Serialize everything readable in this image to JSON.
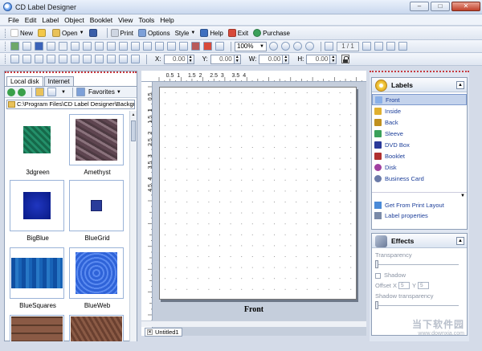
{
  "window": {
    "title": "CD Label Designer",
    "minimize": "–",
    "maximize": "□",
    "close": "✕"
  },
  "menu": [
    "File",
    "Edit",
    "Label",
    "Object",
    "Booklet",
    "View",
    "Tools",
    "Help"
  ],
  "toolbar1": {
    "new": "New",
    "open": "Open",
    "print": "Print",
    "options": "Options",
    "style": "Style",
    "help": "Help",
    "exit": "Exit",
    "purchase": "Purchase"
  },
  "toolbar2": {
    "zoom": "100%",
    "page": "1 / 1"
  },
  "toolbar3": {
    "x_label": "X:",
    "x_value": "0.00",
    "y_label": "Y:",
    "y_value": "0.00",
    "w_label": "W:",
    "w_value": "0.00",
    "h_label": "H:",
    "h_value": "0.00"
  },
  "left_panel": {
    "tabs": [
      "Local disk",
      "Internet"
    ],
    "favorites": "Favorites",
    "path": "C:\\Program Files\\CD Label Designer\\Backgrounds",
    "thumbs": [
      {
        "label": "3dgreen",
        "color": "#1e7a55"
      },
      {
        "label": "Amethyst",
        "color": "#6e5560"
      },
      {
        "label": "BigBlue",
        "color": "#0d1fa0"
      },
      {
        "label": "BlueGrid",
        "color": "#2a3c9a"
      },
      {
        "label": "BlueSquares",
        "color": "#4f9fd8"
      },
      {
        "label": "BlueWeb",
        "color": "#2f63d8"
      },
      {
        "label": "",
        "color": "#8a5a45"
      },
      {
        "label": "",
        "color": "#6a4030"
      }
    ]
  },
  "ruler": {
    "h": [
      "0.5",
      "1",
      "1.5",
      "2",
      "2.5",
      "3",
      "3.5",
      "4"
    ],
    "v": [
      "0.5",
      "1",
      "1.5",
      "2",
      "2.5",
      "3",
      "3.5",
      "4",
      "4.5"
    ]
  },
  "canvas": {
    "label": "Front"
  },
  "doc_tab": "Untitled1",
  "labels_panel": {
    "title": "Labels",
    "items": [
      "Front",
      "Inside",
      "Back",
      "Sleeve",
      "DVD Box",
      "Booklet",
      "Disk",
      "Business Card"
    ],
    "selected": 0,
    "actions": [
      "Get From Print Layout",
      "Label properties"
    ]
  },
  "effects_panel": {
    "title": "Effects",
    "transparency": "Transparency",
    "shadow": "Shadow",
    "offset_x_label": "Offset X",
    "offset_x": "5",
    "offset_y_label": "Y",
    "offset_y": "5",
    "shadow_transparency": "Shadow transparency"
  },
  "watermark": {
    "cn": "当下软件园",
    "url": "www.downxia.com"
  }
}
